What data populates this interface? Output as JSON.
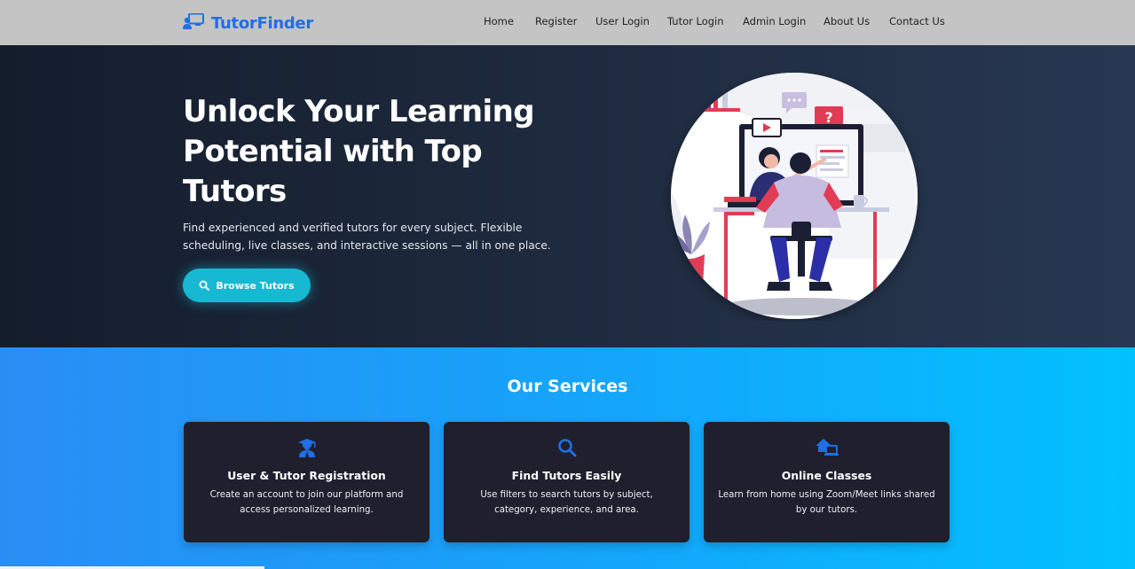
{
  "brand": {
    "name": "TutorFinder"
  },
  "nav": {
    "items": [
      {
        "label": "Home"
      },
      {
        "label": "Register"
      },
      {
        "label": "User Login"
      },
      {
        "label": "Tutor Login"
      },
      {
        "label": "Admin Login"
      },
      {
        "label": "About Us"
      },
      {
        "label": "Contact Us"
      }
    ]
  },
  "hero": {
    "title": "Unlock Your Learning Potential with Top Tutors",
    "subtitle": "Find experienced and verified tutors for every subject. Flexible scheduling, live classes, and interactive sessions — all in one place.",
    "button_label": "Browse Tutors",
    "button_icon": "search-icon",
    "illustration_icon": "online-tutoring-illustration"
  },
  "services": {
    "title": "Our Services",
    "cards": [
      {
        "icon": "graduate-icon",
        "title": "User & Tutor Registration",
        "description": "Create an account to join our platform and access personalized learning."
      },
      {
        "icon": "search-icon",
        "title": "Find Tutors Easily",
        "description": "Use filters to search tutors by subject, category, experience, and area."
      },
      {
        "icon": "online-class-icon",
        "title": "Online Classes",
        "description": "Learn from home using Zoom/Meet links shared by our tutors."
      }
    ]
  },
  "colors": {
    "accent": "#1f6fe5",
    "button": "#17b8d1",
    "hero_bg": "#1e2a3e",
    "services_bg": "#14a6fb",
    "card_bg": "#1f1f2d"
  }
}
